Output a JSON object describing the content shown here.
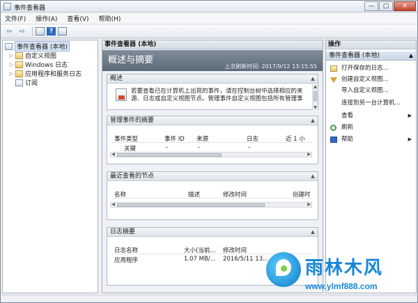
{
  "window": {
    "title": "事件查看器",
    "minimize": "—",
    "maximize": "□",
    "close": "✕"
  },
  "menu": [
    "文件(F)",
    "操作(A)",
    "查看(V)",
    "帮助(H)"
  ],
  "toolbar": {
    "back": "⇦",
    "forward": "⇨",
    "help": "?"
  },
  "tree": {
    "items": [
      {
        "label": "事件查看器 (本地)",
        "expander": "",
        "selected": true
      },
      {
        "label": "自定义视图",
        "expander": "▷"
      },
      {
        "label": "Windows 日志",
        "expander": "▷"
      },
      {
        "label": "应用程序和服务日志",
        "expander": "▷"
      },
      {
        "label": "订阅",
        "expander": ""
      }
    ]
  },
  "center": {
    "header": "事件查看器 (本地)",
    "banner_title": "概述与摘要",
    "last_refresh": "上次刷新时间: 2017/9/12 13:15:55",
    "overview": {
      "title": "概述",
      "text": "若要查看已在计算机上出现的事件，请在控制台树中选择相应的来源、日志或自定义视图节点。管理事件自定义视图包括所有管理事件，而与来源无关。以下所示为所有日志的集合视图。"
    },
    "summary": {
      "title": "管理事件的摘要",
      "columns": [
        "事件类型",
        "事件 ID",
        "来源",
        "日志",
        "近 1 小"
      ],
      "rows": [
        [
          "关键",
          "-",
          "-",
          "-",
          ""
        ]
      ]
    },
    "recent": {
      "title": "最近查看的节点",
      "columns": [
        "名称",
        "描述",
        "修改时间",
        "创建时"
      ]
    },
    "logsummary": {
      "title": "日志摘要",
      "columns": [
        "日志名称",
        "大小(当前...",
        "修改时间",
        ""
      ],
      "rows": [
        [
          "应用程序",
          "1.07 MB/...",
          "2016/5/11 13...",
          ""
        ]
      ]
    }
  },
  "actions": {
    "header": "操作",
    "group": "事件查看器 (本地)",
    "group_arrow": "▲",
    "items": [
      {
        "label": "打开保存的日志...",
        "icon": "folder-open-icon",
        "sub": ""
      },
      {
        "label": "创建自定义视图...",
        "icon": "filter-icon",
        "sub": ""
      },
      {
        "label": "导入自定义视图...",
        "icon": "import-icon",
        "sub": ""
      },
      {
        "label": "连接到另一台计算机...",
        "icon": "",
        "sub": ""
      },
      {
        "label": "查看",
        "icon": "",
        "sub": "▶"
      },
      {
        "label": "刷新",
        "icon": "refresh-icon",
        "sub": ""
      },
      {
        "label": "帮助",
        "icon": "help-icon",
        "sub": "▶"
      }
    ]
  },
  "watermark": {
    "name": "雨林木风",
    "url": "www.ylmf888.com"
  }
}
